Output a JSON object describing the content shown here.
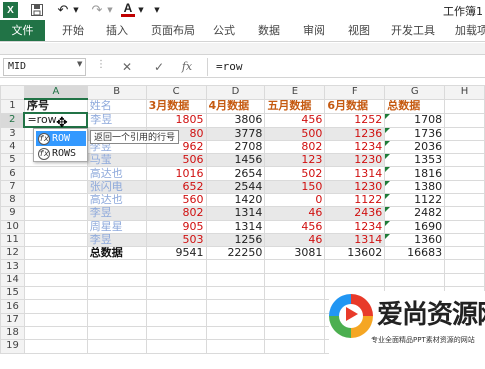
{
  "window": {
    "title": "工作簿1",
    "excel_logo": "X"
  },
  "quick_access": {
    "save_icon": "save-icon",
    "undo_icon": "undo-icon",
    "redo_icon": "redo-icon",
    "font_color_label": "A",
    "font_color": "#c00000"
  },
  "ribbon": {
    "tabs": [
      "文件",
      "开始",
      "插入",
      "页面布局",
      "公式",
      "数据",
      "审阅",
      "视图",
      "开发工具",
      "加载项"
    ],
    "file_bg": "#217346"
  },
  "formula_bar": {
    "name_box": "MID",
    "cancel_symbol": "✕",
    "enter_symbol": "✓",
    "fx_label": "fx",
    "value": "=row"
  },
  "grid": {
    "columns": [
      "A",
      "B",
      "C",
      "D",
      "E",
      "F",
      "G",
      "H"
    ],
    "rows": [
      {
        "n": "1",
        "a": "序号",
        "b": "姓名",
        "c": "3月数据",
        "d": "4月数据",
        "e": "五月数据",
        "f": "6月数据",
        "g": "总数据"
      },
      {
        "n": "2",
        "a": "=row",
        "b": "李昱",
        "c": "1805",
        "d": "3806",
        "e": "456",
        "f": "1252",
        "g": "1708"
      },
      {
        "n": "3",
        "a": "",
        "b": "",
        "c": "80",
        "d": "3778",
        "e": "500",
        "f": "1236",
        "g": "1736"
      },
      {
        "n": "4",
        "a": "",
        "b": "李昱",
        "c": "962",
        "d": "2708",
        "e": "802",
        "f": "1234",
        "g": "2036"
      },
      {
        "n": "5",
        "a": "",
        "b": "马莹",
        "c": "506",
        "d": "1456",
        "e": "123",
        "f": "1230",
        "g": "1353"
      },
      {
        "n": "6",
        "a": "",
        "b": "高达也",
        "c": "1016",
        "d": "2654",
        "e": "502",
        "f": "1314",
        "g": "1816"
      },
      {
        "n": "7",
        "a": "",
        "b": "张闪电",
        "c": "652",
        "d": "2544",
        "e": "150",
        "f": "1230",
        "g": "1380"
      },
      {
        "n": "8",
        "a": "",
        "b": "高达也",
        "c": "560",
        "d": "1420",
        "e": "0",
        "f": "1122",
        "g": "1122"
      },
      {
        "n": "9",
        "a": "",
        "b": "李昱",
        "c": "802",
        "d": "1314",
        "e": "46",
        "f": "2436",
        "g": "2482"
      },
      {
        "n": "10",
        "a": "",
        "b": "周星星",
        "c": "905",
        "d": "1314",
        "e": "456",
        "f": "1234",
        "g": "1690"
      },
      {
        "n": "11",
        "a": "",
        "b": "李昱",
        "c": "503",
        "d": "1256",
        "e": "46",
        "f": "1314",
        "g": "1360"
      },
      {
        "n": "12",
        "a": "",
        "b": "总数据",
        "c": "9541",
        "d": "22250",
        "e": "3081",
        "f": "13602",
        "g": "16683"
      },
      {
        "n": "13",
        "a": "",
        "b": "",
        "c": "",
        "d": "",
        "e": "",
        "f": "",
        "g": ""
      },
      {
        "n": "14",
        "a": "",
        "b": "",
        "c": "",
        "d": "",
        "e": "",
        "f": "",
        "g": ""
      },
      {
        "n": "15",
        "a": "",
        "b": "",
        "c": "",
        "d": "",
        "e": "",
        "f": "",
        "g": ""
      },
      {
        "n": "16",
        "a": "",
        "b": "",
        "c": "",
        "d": "",
        "e": "",
        "f": "",
        "g": ""
      },
      {
        "n": "17",
        "a": "",
        "b": "",
        "c": "",
        "d": "",
        "e": "",
        "f": "",
        "g": ""
      },
      {
        "n": "18",
        "a": "",
        "b": "",
        "c": "",
        "d": "",
        "e": "",
        "f": "",
        "g": ""
      },
      {
        "n": "19",
        "a": "",
        "b": "",
        "c": "",
        "d": "",
        "e": "",
        "f": "",
        "g": ""
      }
    ],
    "header_color": "#c55a11",
    "name_color": "#8ea9db",
    "red_value_color": "#d01010"
  },
  "autocomplete": {
    "items": [
      {
        "icon": "function-icon",
        "label": "ROW"
      },
      {
        "icon": "function-icon",
        "label": "ROWS"
      }
    ],
    "selected_prefix": "R",
    "selected_suffix": "W",
    "tooltip": "返回一个引用的行号"
  },
  "watermark": {
    "name": "爱尚资源网",
    "subtitle": "专业全面精品PPT素材资源的网站"
  }
}
